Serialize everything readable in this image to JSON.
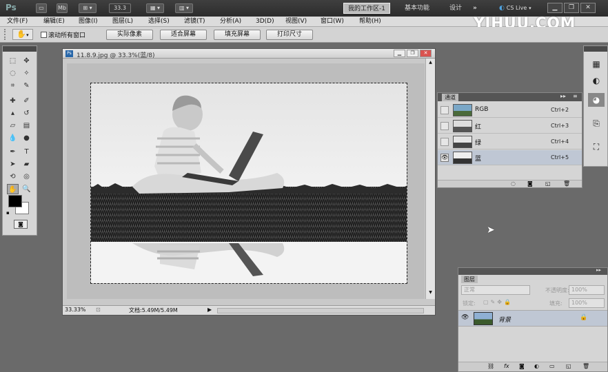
{
  "appbar": {
    "logo": "Ps",
    "zoom": "33.3",
    "workspace_tabs": [
      "我的工作区-1",
      "基本功能",
      "设计",
      "»"
    ],
    "cslive": "CS Live",
    "buttons": [
      "▭",
      "Mb",
      "⊞ ▾",
      "▦ ▾",
      "▥ ▾"
    ]
  },
  "menubar": {
    "items": [
      "文件(F)",
      "编辑(E)",
      "图像(I)",
      "图层(L)",
      "选择(S)",
      "滤镜(T)",
      "分析(A)",
      "3D(D)",
      "视图(V)",
      "窗口(W)",
      "帮助(H)"
    ]
  },
  "watermark": "YIHUU.COM",
  "options": {
    "checkbox_label": "滚动所有窗口",
    "checkbox_checked": false,
    "buttons": [
      "实际像素",
      "适合屏幕",
      "填充屏幕",
      "打印尺寸"
    ]
  },
  "document": {
    "title": "11.8.9.jpg @ 33.3%(蓝/8)",
    "zoom": "33.33%",
    "doc_info": "文档:5.49M/5.49M"
  },
  "channels": {
    "tab": "通道",
    "rows": [
      {
        "name": "RGB",
        "shortcut": "Ctrl+2",
        "visible": false,
        "active": false
      },
      {
        "name": "红",
        "shortcut": "Ctrl+3",
        "visible": false,
        "active": false
      },
      {
        "name": "绿",
        "shortcut": "Ctrl+4",
        "visible": false,
        "active": false
      },
      {
        "name": "蓝",
        "shortcut": "Ctrl+5",
        "visible": true,
        "active": true
      }
    ]
  },
  "layers": {
    "tab": "图层",
    "blend_mode": "正常",
    "opacity_label": "不透明度:",
    "opacity": "100%",
    "lock_label": "锁定:",
    "fill_label": "填充:",
    "fill": "100%",
    "layer_name": "背景"
  },
  "colors": {
    "foreground": "#000000",
    "background": "#ffffff"
  }
}
